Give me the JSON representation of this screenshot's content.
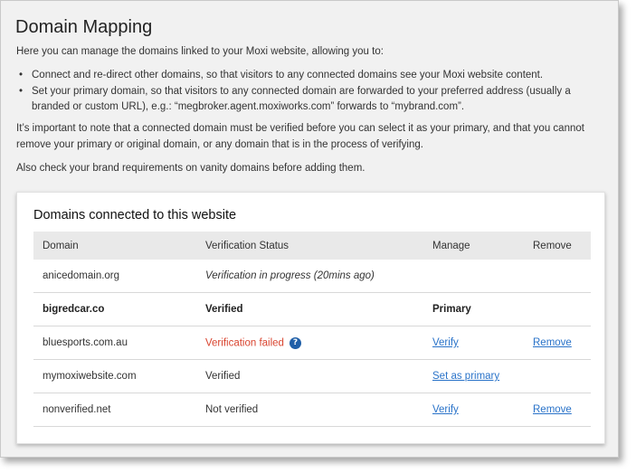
{
  "page": {
    "title": "Domain Mapping",
    "intro": "Here you can manage the domains linked to your Moxi website, allowing you to:",
    "bullets": [
      "Connect and re-direct other domains, so that visitors to any connected domains see your Moxi website content.",
      "Set your primary domain, so that visitors to any connected domain are forwarded to your preferred address (usually a branded or custom URL), e.g.: “megbroker.agent.moxiworks.com” forwards to “mybrand.com”."
    ],
    "note": "It’s important to note that a connected domain must be verified before you can select it as your primary, and that you cannot remove your primary or original domain, or any domain that is in the process of verifying.",
    "brand_note": "Also check your brand requirements on vanity domains before adding them."
  },
  "card": {
    "title": "Domains connected to this website",
    "columns": [
      "Domain",
      "Verification Status",
      "Manage",
      "Remove"
    ],
    "rows": [
      {
        "domain": "anicedomain.org",
        "status": "Verification in progress (20mins ago)",
        "manage": "",
        "remove": ""
      },
      {
        "domain": "bigredcar.co",
        "status": "Verified",
        "manage": "Primary",
        "remove": ""
      },
      {
        "domain": "bluesports.com.au",
        "status": "Verification failed",
        "manage": "Verify",
        "remove": "Remove"
      },
      {
        "domain": "mymoxiwebsite.com",
        "status": "Verified",
        "manage": "Set as primary",
        "remove": ""
      },
      {
        "domain": "nonverified.net",
        "status": "Not verified",
        "manage": "Verify",
        "remove": "Remove"
      }
    ]
  },
  "icons": {
    "help": "?"
  },
  "colors": {
    "link": "#2a73c9",
    "error": "#d9442f",
    "help_icon": "#1f5fa8"
  }
}
